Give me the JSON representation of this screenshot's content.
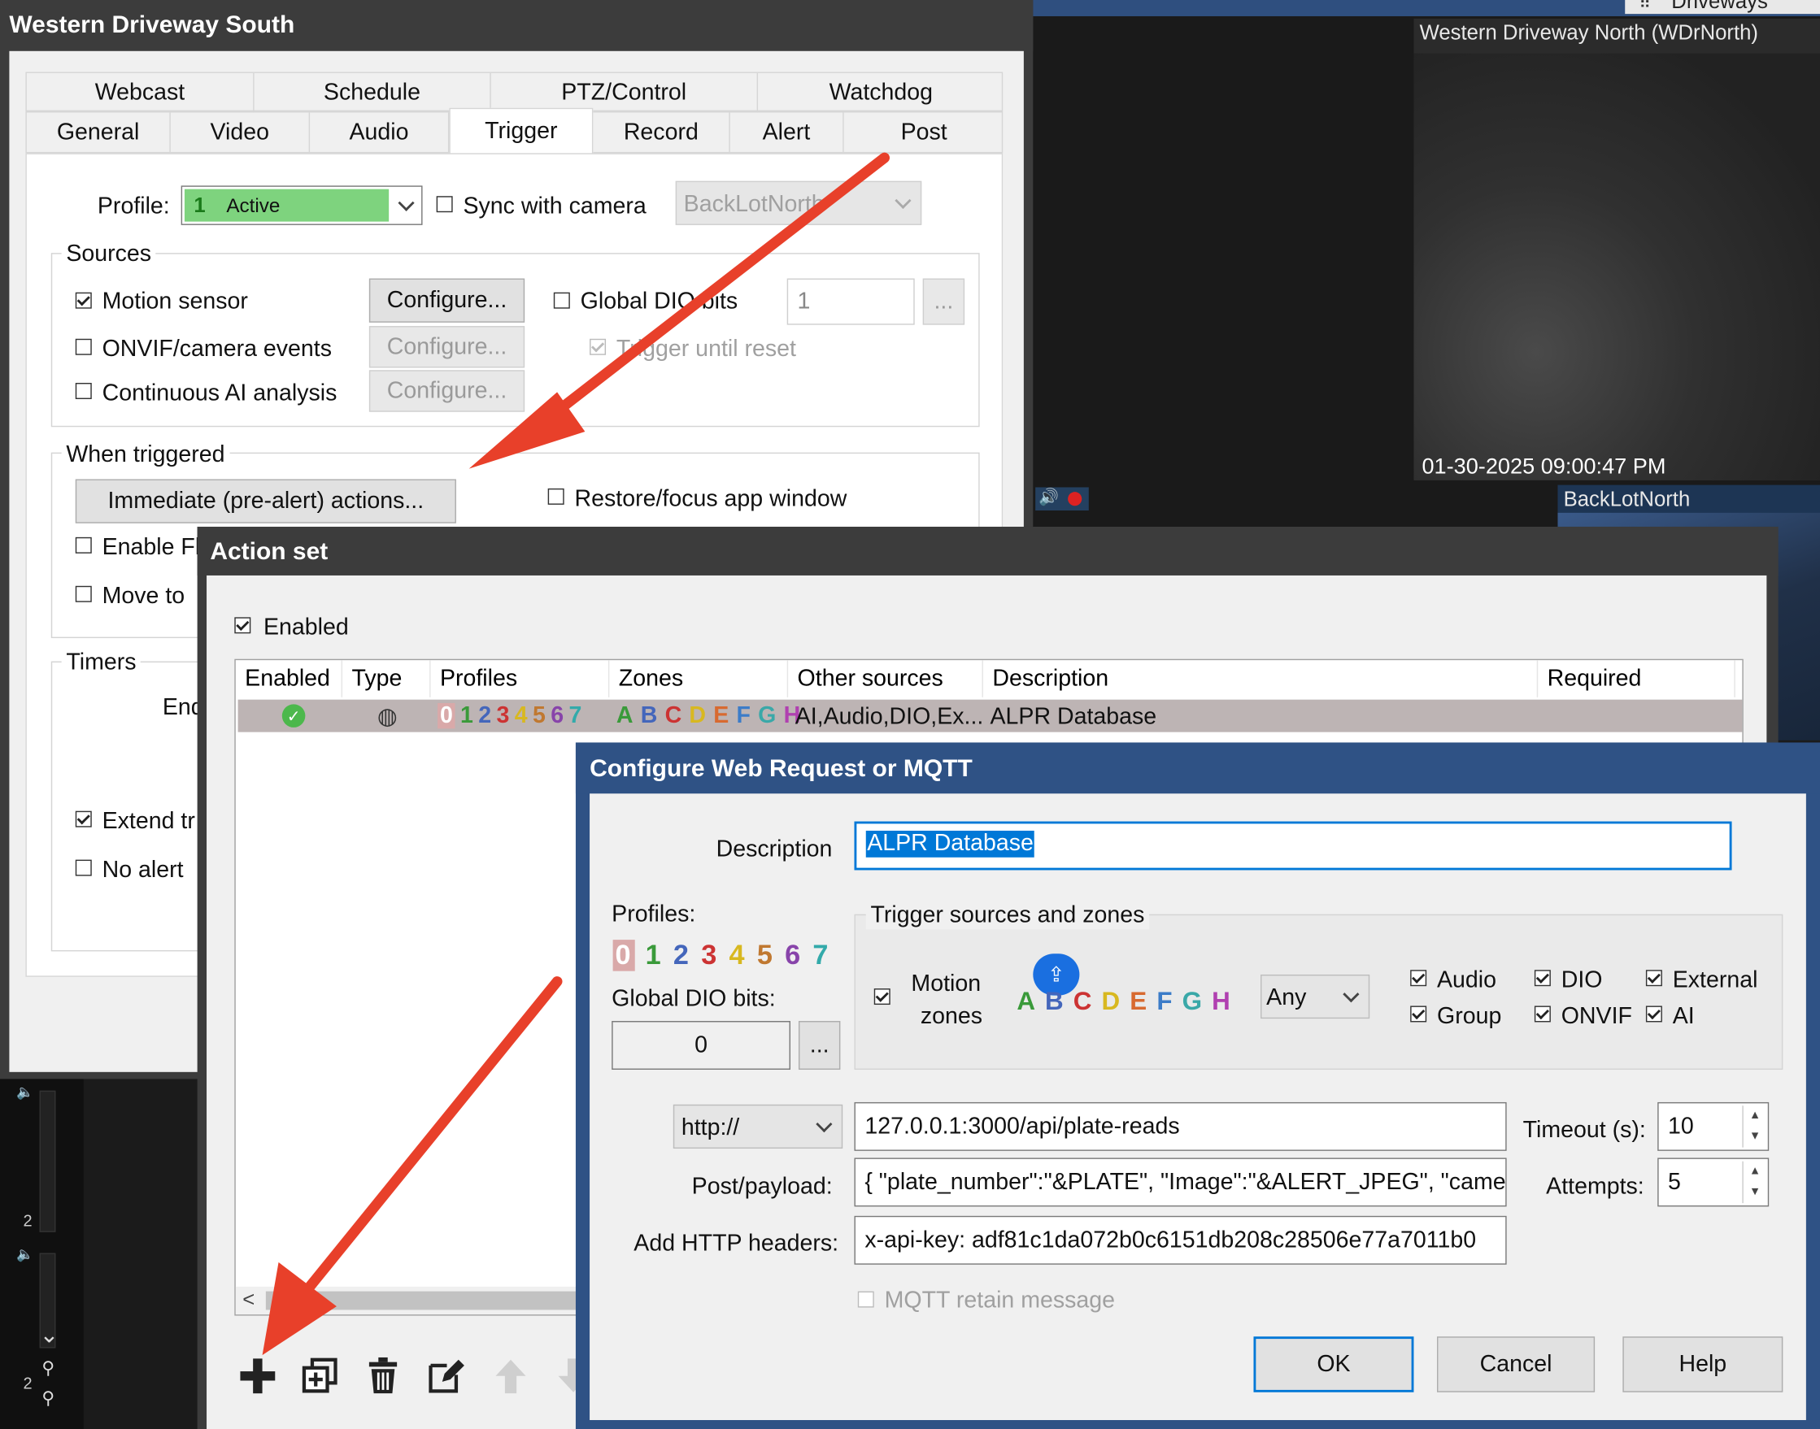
{
  "background": {
    "top_right_label": "Driveways",
    "cam_north": {
      "title": "Western Driveway North (WDrNorth)",
      "timestamp": "01-30-2025 09:00:47 PM"
    },
    "cam_backlot": {
      "title": "BackLotNorth"
    },
    "side_numbers": [
      "2",
      "2"
    ]
  },
  "camera_dialog": {
    "title": "Western Driveway South",
    "tabs_row1": [
      "Webcast",
      "Schedule",
      "PTZ/Control",
      "Watchdog"
    ],
    "tabs_row2": [
      "General",
      "Video",
      "Audio",
      "Trigger",
      "Record",
      "Alert",
      "Post"
    ],
    "active_tab": "Trigger",
    "profile_label": "Profile:",
    "profile_number": "1",
    "profile_value": "Active",
    "sync_label": "Sync with camera",
    "sync_camera_value": "BackLotNorth",
    "sources_label": "Sources",
    "motion_sensor_label": "Motion sensor",
    "onvif_label": "ONVIF/camera events",
    "continuous_ai_label": "Continuous AI analysis",
    "configure_label": "Configure...",
    "global_dio_label": "Global DIO bits",
    "global_dio_value": "1",
    "ellipsis_label": "...",
    "trigger_until_reset_label": "Trigger until reset",
    "when_triggered_label": "When triggered",
    "immediate_actions_label": "Immediate (pre-alert) actions...",
    "restore_focus_label": "Restore/focus app window",
    "enable_label": "Enable Fl",
    "move_to_label": "Move to",
    "timers_label": "Timers",
    "end_label": "End",
    "extend_label": "Extend tr",
    "no_alert_label": "No alert"
  },
  "action_set": {
    "title": "Action set",
    "enabled_label": "Enabled",
    "columns": [
      "Enabled",
      "Type",
      "Profiles",
      "Zones",
      "Other sources",
      "Description",
      "Required"
    ],
    "row": {
      "profiles": [
        "0",
        "1",
        "2",
        "3",
        "4",
        "5",
        "6",
        "7"
      ],
      "zones": [
        "A",
        "B",
        "C",
        "D",
        "E",
        "F",
        "G",
        "H"
      ],
      "other_sources": "AI,Audio,DIO,Ex...",
      "description": "ALPR Database"
    },
    "scroll_left": "<"
  },
  "web_request": {
    "title": "Configure Web Request or MQTT",
    "description_label": "Description",
    "description_value": "ALPR Database",
    "profiles_label": "Profiles:",
    "profiles": [
      "0",
      "1",
      "2",
      "3",
      "4",
      "5",
      "6",
      "7"
    ],
    "trigger_sources_label": "Trigger sources and zones",
    "motion_zones_label_1": "Motion",
    "motion_zones_label_2": "zones",
    "zones": [
      "A",
      "B",
      "C",
      "D",
      "E",
      "F",
      "G",
      "H"
    ],
    "zone_mode": "Any",
    "global_dio_label": "Global DIO bits:",
    "global_dio_value": "0",
    "ellipsis_label": "...",
    "src_audio": "Audio",
    "src_dio": "DIO",
    "src_external": "External",
    "src_group": "Group",
    "src_onvif": "ONVIF",
    "src_ai": "AI",
    "protocol": "http://",
    "url": "127.0.0.1:3000/api/plate-reads",
    "timeout_label": "Timeout (s):",
    "timeout_value": "10",
    "post_label": "Post/payload:",
    "post_value": "{ \"plate_number\":\"&PLATE\", \"Image\":\"&ALERT_JPEG\", \"came",
    "attempts_label": "Attempts:",
    "attempts_value": "5",
    "headers_label": "Add HTTP headers:",
    "headers_value": "x-api-key: adf81c1da072b0c6151db208c28506e77a7011b0",
    "mqtt_retain_label": "MQTT retain message",
    "ok_label": "OK",
    "cancel_label": "Cancel",
    "help_label": "Help"
  },
  "colors": {
    "profile_digits": [
      "#d9a9a9",
      "#3a9a3a",
      "#4466bb",
      "#cc3333",
      "#d8b820",
      "#c07830",
      "#8844aa",
      "#33aaaa"
    ],
    "zone_letters": [
      "#3a9a3a",
      "#4466bb",
      "#cc3333",
      "#d8b820",
      "#d86a30",
      "#3c7cc8",
      "#3aa8a8",
      "#b040b0"
    ],
    "arrow": "#e8402a",
    "title_dark": "#3c3c3c",
    "title_blue": "#2f5285",
    "selection": "#0078d7"
  }
}
